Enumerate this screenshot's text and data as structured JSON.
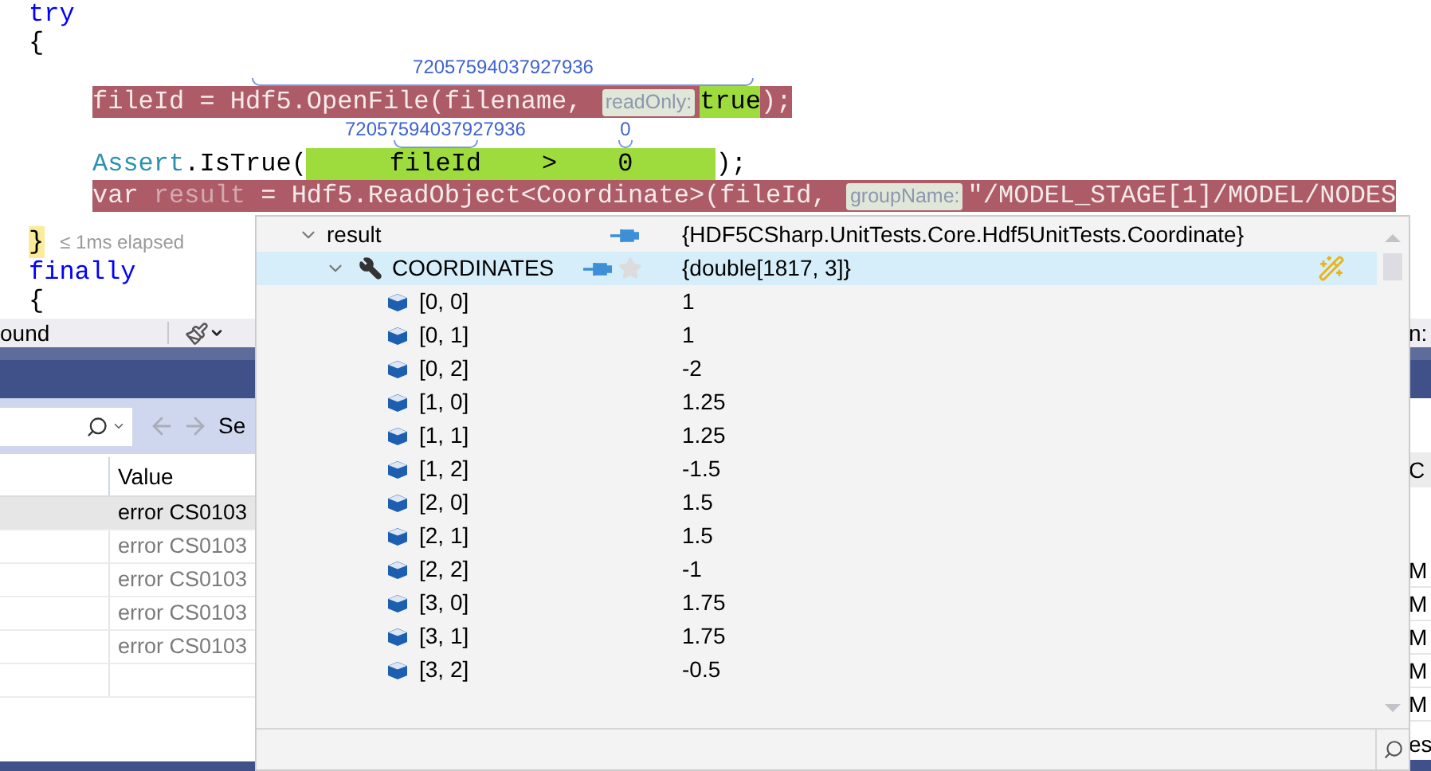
{
  "code": {
    "blocks": [
      {
        "keyword": "try",
        "open": "{",
        "close": "}",
        "elapsed": "≤ 1ms elapsed",
        "statements": [
          {
            "highlighted": true,
            "parts": [
              {
                "kind": "code",
                "text": "fileId = "
              },
              {
                "kind": "group",
                "annotation": "72057594037927936",
                "parts": [
                  {
                    "kind": "code",
                    "text": "Hdf5.OpenFile(filename, "
                  },
                  {
                    "kind": "hint",
                    "text": "readOnly:"
                  },
                  {
                    "kind": "value",
                    "text": "true"
                  },
                  {
                    "kind": "code",
                    "text": ")"
                  }
                ]
              },
              {
                "kind": "code",
                "text": ";"
              }
            ]
          },
          {
            "highlighted": false,
            "parts": [
              {
                "kind": "type",
                "text": "Assert"
              },
              {
                "kind": "code",
                "text": ".IsTrue("
              },
              {
                "kind": "condition",
                "parts": [
                  {
                    "kind": "group",
                    "annotation": "72057594037927936",
                    "parts": [
                      {
                        "kind": "code",
                        "text": "fileId"
                      }
                    ]
                  },
                  {
                    "kind": "code",
                    "text": ">"
                  },
                  {
                    "kind": "group",
                    "annotation": "0",
                    "parts": [
                      {
                        "kind": "code",
                        "text": "0"
                      }
                    ]
                  }
                ]
              },
              {
                "kind": "code",
                "text": ");"
              }
            ]
          },
          {
            "highlighted": true,
            "parts": [
              {
                "kind": "keyword",
                "text": "var"
              },
              {
                "kind": "local",
                "text": "result"
              },
              {
                "kind": "code",
                "text": " = Hdf5.ReadObject<Coordinate>(fileId, "
              },
              {
                "kind": "hint",
                "text": "groupName:"
              },
              {
                "kind": "code",
                "text": "\"/MODEL_STAGE[1]/MODEL/NODES"
              }
            ]
          }
        ]
      },
      {
        "keyword": "finally",
        "open": "{"
      }
    ]
  },
  "panel": {
    "toolbar_label": "ound",
    "search_label": "Se",
    "columns": [
      "Value"
    ],
    "rows": [
      {
        "value": "error CS0103",
        "selected": true
      },
      {
        "value": "error CS0103",
        "selected": false
      },
      {
        "value": "error CS0103",
        "selected": false
      },
      {
        "value": "error CS0103",
        "selected": false
      },
      {
        "value": "error CS0103",
        "selected": false
      }
    ]
  },
  "side_strip": {
    "label": "n:",
    "header": "C",
    "rows": [
      "M",
      "M",
      "M",
      "M",
      "M"
    ],
    "footer": "es"
  },
  "datatip": {
    "items": [
      {
        "kind": "variable",
        "name": "result",
        "value": "{HDF5CSharp.UnitTests.Core.Hdf5UnitTests.Coordinate}",
        "expanded": true,
        "selected": false,
        "children": [
          {
            "kind": "property",
            "name": "COORDINATES",
            "value": "{double[1817, 3]}",
            "expanded": true,
            "selected": true,
            "children": [
              {
                "kind": "element",
                "name": "[0, 0]",
                "value": "1"
              },
              {
                "kind": "element",
                "name": "[0, 1]",
                "value": "1"
              },
              {
                "kind": "element",
                "name": "[0, 2]",
                "value": "-2"
              },
              {
                "kind": "element",
                "name": "[1, 0]",
                "value": "1.25"
              },
              {
                "kind": "element",
                "name": "[1, 1]",
                "value": "1.25"
              },
              {
                "kind": "element",
                "name": "[1, 2]",
                "value": "-1.5"
              },
              {
                "kind": "element",
                "name": "[2, 0]",
                "value": "1.5"
              },
              {
                "kind": "element",
                "name": "[2, 1]",
                "value": "1.5"
              },
              {
                "kind": "element",
                "name": "[2, 2]",
                "value": "-1"
              },
              {
                "kind": "element",
                "name": "[3, 0]",
                "value": "1.75"
              },
              {
                "kind": "element",
                "name": "[3, 1]",
                "value": "1.75"
              },
              {
                "kind": "element",
                "name": "[3, 2]",
                "value": "-0.5"
              }
            ]
          }
        ]
      }
    ]
  }
}
